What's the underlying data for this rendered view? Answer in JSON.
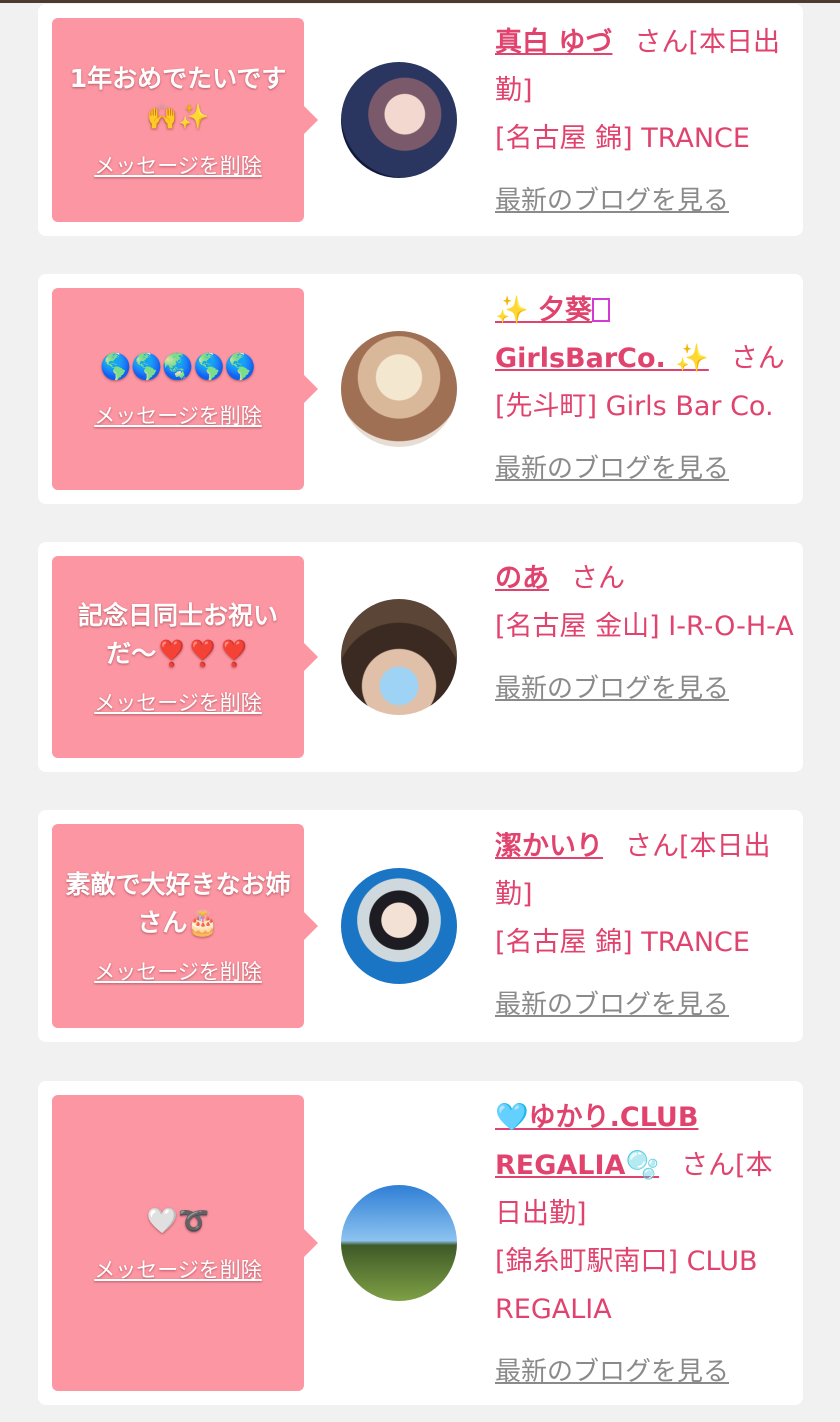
{
  "cards": [
    {
      "message": "1年おめでたいです 🙌✨",
      "delete_label": "メッセージを削除",
      "name": "真白 ゆづ",
      "san": "さん[本日出勤]",
      "shop": "[名古屋 錦] TRANCE",
      "blog_label": "最新のブログを見る",
      "avatar_desc": "woman-portrait-photo"
    },
    {
      "message": "🌎🌎🌏🌎🌎",
      "delete_label": "メッセージを削除",
      "name": "✨ 夕葵",
      "name2": "GirlsBarCo. ✨",
      "san": "さん",
      "shop": "[先斗町] Girls Bar Co.",
      "blog_label": "最新のブログを見る",
      "avatar_desc": "face-covered-sticker-photo"
    },
    {
      "message": "記念日同士お祝いだ〜❣️❣️❣️",
      "delete_label": "メッセージを削除",
      "name": "のあ",
      "san": "さん",
      "shop": "[名古屋 金山] I-R-O-H-A",
      "blog_label": "最新のブログを見る",
      "avatar_desc": "girl-with-tiara-photo"
    },
    {
      "message": "素敵で大好きなお姉さん🎂",
      "delete_label": "メッセージを削除",
      "name": "潔かいり",
      "san": "さん[本日出勤]",
      "shop": "[名古屋 錦] TRANCE",
      "blog_label": "最新のブログを見る",
      "avatar_desc": "girl-blue-background-photo"
    },
    {
      "message": "🤍➰",
      "delete_label": "メッセージを削除",
      "name": "🩵ゆかり.CLUB REGALIA🫧",
      "san": "さん[本日出勤]",
      "shop": "[錦糸町駅南口] CLUB REGALIA",
      "blog_label": "最新のブログを見る",
      "avatar_desc": "park-landscape-photo"
    }
  ]
}
